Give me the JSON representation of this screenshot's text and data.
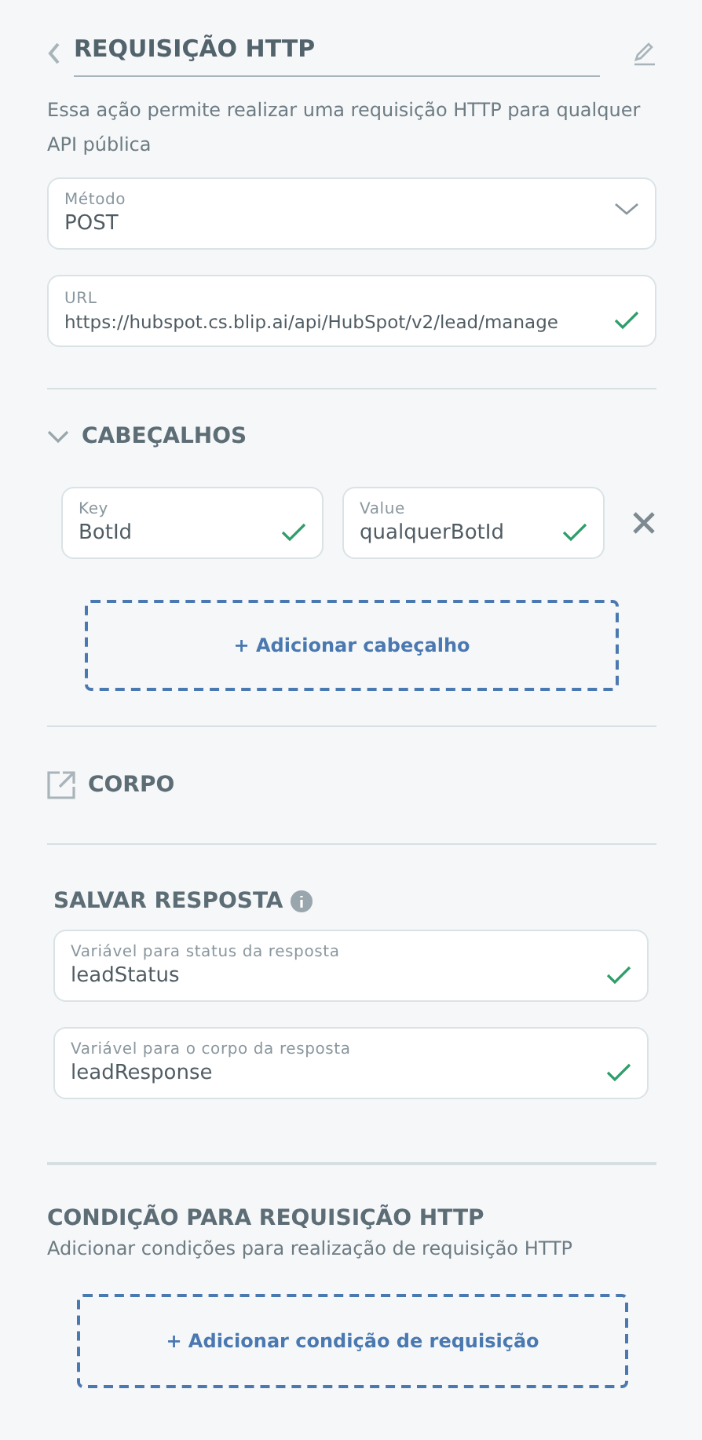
{
  "header": {
    "title": "REQUISIÇÃO HTTP",
    "description": "Essa ação permite realizar uma requisição HTTP para qualquer API pública"
  },
  "method": {
    "label": "Método",
    "value": "POST"
  },
  "url": {
    "label": "URL",
    "value": "https://hubspot.cs.blip.ai/api/HubSpot/v2/lead/manage",
    "valid": true
  },
  "headers_section": {
    "title": "CABEÇALHOS",
    "expanded": true,
    "rows": [
      {
        "key_label": "Key",
        "key": "BotId",
        "key_valid": true,
        "value_label": "Value",
        "value": "qualquerBotId",
        "value_valid": true
      }
    ],
    "add_button": "+ Adicionar cabeçalho"
  },
  "body_section": {
    "title": "CORPO"
  },
  "save_response": {
    "title": "SALVAR RESPOSTA",
    "fields": [
      {
        "label": "Variável para status da resposta",
        "value": "leadStatus",
        "valid": true
      },
      {
        "label": "Variável para o corpo da resposta",
        "value": "leadResponse",
        "valid": true
      }
    ]
  },
  "condition": {
    "title": "CONDIÇÃO PARA REQUISIÇÃO HTTP",
    "description": "Adicionar condições para realização de requisição HTTP",
    "add_button": "+ Adicionar condição de requisição"
  }
}
